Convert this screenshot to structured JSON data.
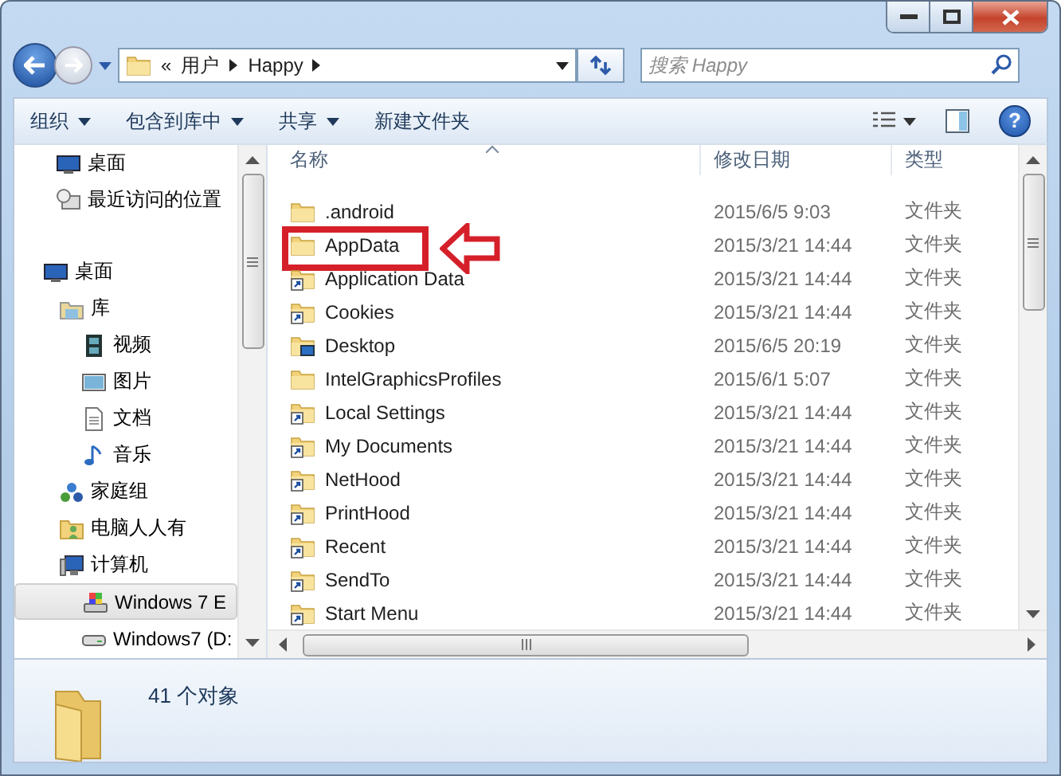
{
  "address": {
    "crumbs": [
      "«",
      "用户",
      "Happy"
    ]
  },
  "search": {
    "placeholder": "搜索 Happy"
  },
  "toolbar": {
    "buttons": [
      {
        "label": "组织",
        "dropdown": true
      },
      {
        "label": "包含到库中",
        "dropdown": true
      },
      {
        "label": "共享",
        "dropdown": true
      },
      {
        "label": "新建文件夹",
        "dropdown": false
      }
    ],
    "help": "?"
  },
  "sidebar": {
    "items": [
      {
        "label": "桌面",
        "kind": "monitor",
        "selected": false
      },
      {
        "label": "最近访问的位置",
        "kind": "recent",
        "selected": false
      },
      {
        "label": "桌面",
        "kind": "monitor",
        "selected": false,
        "children": [
          {
            "label": "库",
            "kind": "library",
            "selected": false,
            "children": [
              {
                "label": "视频",
                "kind": "video",
                "selected": false
              },
              {
                "label": "图片",
                "kind": "picture",
                "selected": false
              },
              {
                "label": "文档",
                "kind": "document",
                "selected": false
              },
              {
                "label": "音乐",
                "kind": "music",
                "selected": false
              }
            ]
          },
          {
            "label": "家庭组",
            "kind": "homegroup",
            "selected": false
          },
          {
            "label": "电脑人人有",
            "kind": "user",
            "selected": false
          },
          {
            "label": "计算机",
            "kind": "computer",
            "selected": false,
            "children": [
              {
                "label": "Windows 7 E",
                "kind": "system-drive",
                "selected": true
              },
              {
                "label": "Windows7 (D:",
                "kind": "drive",
                "selected": false
              }
            ]
          }
        ]
      }
    ]
  },
  "table": {
    "columns": [
      "名称",
      "修改日期",
      "类型"
    ],
    "rows": [
      {
        "name": ".android",
        "date": "2015/6/5 9:03",
        "type": "文件夹",
        "kind": "folder",
        "highlighted": false
      },
      {
        "name": "AppData",
        "date": "2015/3/21 14:44",
        "type": "文件夹",
        "kind": "folder",
        "highlighted": true
      },
      {
        "name": "Application Data",
        "date": "2015/3/21 14:44",
        "type": "文件夹",
        "kind": "shortcut",
        "highlighted": false
      },
      {
        "name": "Cookies",
        "date": "2015/3/21 14:44",
        "type": "文件夹",
        "kind": "shortcut",
        "highlighted": false
      },
      {
        "name": "Desktop",
        "date": "2015/6/5 20:19",
        "type": "文件夹",
        "kind": "desktop",
        "highlighted": false
      },
      {
        "name": "IntelGraphicsProfiles",
        "date": "2015/6/1 5:07",
        "type": "文件夹",
        "kind": "folder",
        "highlighted": false
      },
      {
        "name": "Local Settings",
        "date": "2015/3/21 14:44",
        "type": "文件夹",
        "kind": "shortcut",
        "highlighted": false
      },
      {
        "name": "My Documents",
        "date": "2015/3/21 14:44",
        "type": "文件夹",
        "kind": "shortcut",
        "highlighted": false
      },
      {
        "name": "NetHood",
        "date": "2015/3/21 14:44",
        "type": "文件夹",
        "kind": "shortcut",
        "highlighted": false
      },
      {
        "name": "PrintHood",
        "date": "2015/3/21 14:44",
        "type": "文件夹",
        "kind": "shortcut",
        "highlighted": false
      },
      {
        "name": "Recent",
        "date": "2015/3/21 14:44",
        "type": "文件夹",
        "kind": "shortcut",
        "highlighted": false
      },
      {
        "name": "SendTo",
        "date": "2015/3/21 14:44",
        "type": "文件夹",
        "kind": "shortcut",
        "highlighted": false
      },
      {
        "name": "Start Menu",
        "date": "2015/3/21 14:44",
        "type": "文件夹",
        "kind": "shortcut",
        "highlighted": false
      }
    ]
  },
  "status_bar": {
    "text": "41 个对象"
  }
}
